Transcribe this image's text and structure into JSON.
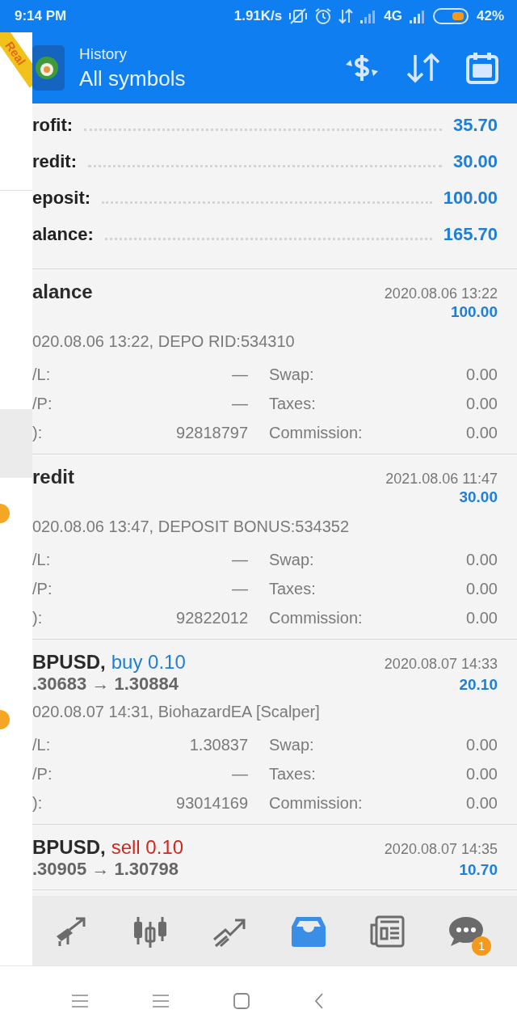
{
  "status_bar": {
    "time": "9:14 PM",
    "speed": "1.91K/s",
    "network": "4G",
    "battery": "42%"
  },
  "account_badge": "Real",
  "app_bar": {
    "subtitle": "History",
    "title": "All symbols"
  },
  "summary": [
    {
      "label": "rofit:",
      "value": "35.70"
    },
    {
      "label": "redit:",
      "value": "30.00"
    },
    {
      "label": "eposit:",
      "value": "100.00"
    },
    {
      "label": "alance:",
      "value": "165.70"
    }
  ],
  "entries": [
    {
      "title": "alance",
      "date": "2020.08.06 13:22",
      "amount": "100.00",
      "comment": "020.08.06 13:22, DEPO RID:534310",
      "rows": [
        [
          "/L:",
          "—",
          "Swap:",
          "0.00"
        ],
        [
          "/P:",
          "—",
          "Taxes:",
          "0.00"
        ],
        [
          "):",
          "92818797",
          "Commission:",
          "0.00"
        ]
      ]
    },
    {
      "title": "redit",
      "date": "2021.08.06 11:47",
      "amount": "30.00",
      "comment": "020.08.06 13:47, DEPOSIT BONUS:534352",
      "rows": [
        [
          "/L:",
          "—",
          "Swap:",
          "0.00"
        ],
        [
          "/P:",
          "—",
          "Taxes:",
          "0.00"
        ],
        [
          "):",
          "92822012",
          "Commission:",
          "0.00"
        ]
      ]
    },
    {
      "kind": "buy",
      "title": "BPUSD,",
      "side": "buy 0.10",
      "prices": ".30683 → 1.30884",
      "date": "2020.08.07 14:33",
      "amount": "20.10",
      "comment": "020.08.07 14:31, BiohazardEA [Scalper]",
      "rows": [
        [
          "/L:",
          "1.30837",
          "Swap:",
          "0.00"
        ],
        [
          "/P:",
          "—",
          "Taxes:",
          "0.00"
        ],
        [
          "):",
          "93014169",
          "Commission:",
          "0.00"
        ]
      ]
    },
    {
      "kind": "sell",
      "title": "BPUSD,",
      "side": "sell 0.10",
      "prices": ".30905 → 1.30798",
      "date": "2020.08.07 14:35",
      "amount": "10.70"
    }
  ],
  "bottom_nav": [
    {
      "kind": "trade",
      "selected": false
    },
    {
      "kind": "chart",
      "selected": false
    },
    {
      "kind": "trend",
      "selected": false
    },
    {
      "kind": "history",
      "selected": true
    },
    {
      "kind": "news",
      "selected": false
    },
    {
      "kind": "chat",
      "selected": false,
      "badge": "1"
    }
  ]
}
